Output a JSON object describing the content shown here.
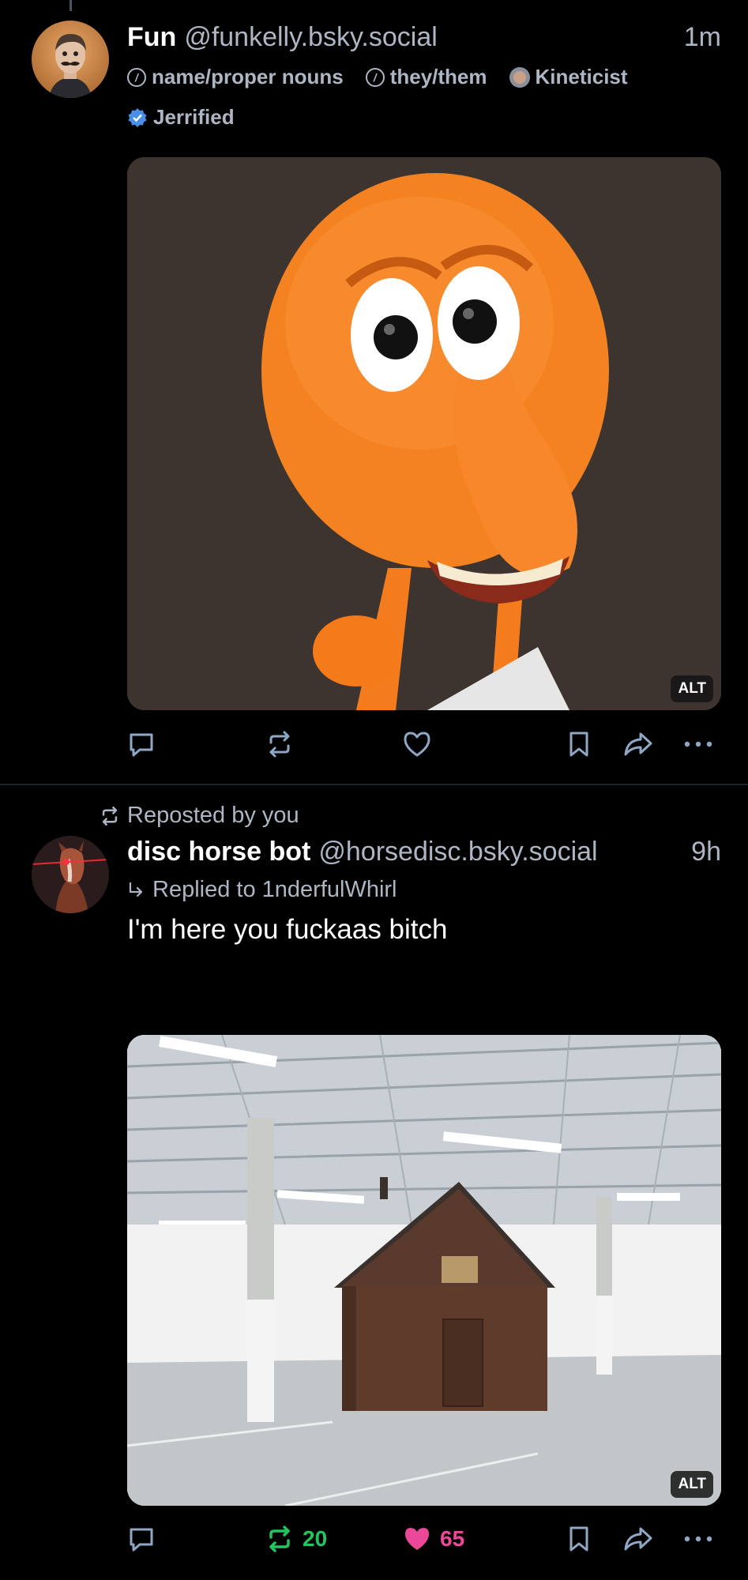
{
  "post1": {
    "display_name": "Fun",
    "handle": "@funkelly.bsky.social",
    "time": "1m",
    "labels": [
      "name/proper nouns",
      "they/them",
      "Kineticist",
      "Jerrified"
    ],
    "alt": "ALT"
  },
  "post2": {
    "repost_text": "Reposted by you",
    "display_name": "disc horse bot",
    "handle": "@horsedisc.bsky.social",
    "time": "9h",
    "reply_text": "Replied to 1nderfulWhirl",
    "text": "I'm here you fuckaas bitch",
    "alt": "ALT",
    "repost_count": "20",
    "like_count": "65"
  },
  "colors": {
    "background": "#000000",
    "muted": "#aeb6c4",
    "icon": "#8fa7c4",
    "repost_active": "#22c55e",
    "like_active": "#ec4899"
  }
}
